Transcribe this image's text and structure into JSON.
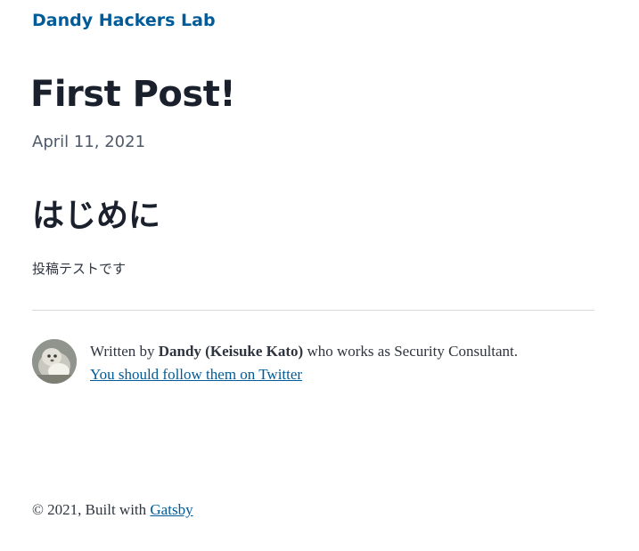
{
  "header": {
    "site_title": "Dandy Hackers Lab"
  },
  "post": {
    "title": "First Post!",
    "date": "April 11, 2021",
    "section_heading": "はじめに",
    "body": "投稿テストです"
  },
  "bio": {
    "avatar_icon": "author-avatar-photo",
    "prefix": "Written by ",
    "author": "Dandy (Keisuke Kato)",
    "suffix": " who works as Security Consultant.",
    "follow_link": "You should follow them on Twitter"
  },
  "footer": {
    "copyright": "© 2021, Built with ",
    "link": "Gatsby"
  },
  "colors": {
    "link": "#005b99",
    "heading": "#1a202c",
    "text": "#2e353f",
    "divider": "#d7d9dc"
  }
}
